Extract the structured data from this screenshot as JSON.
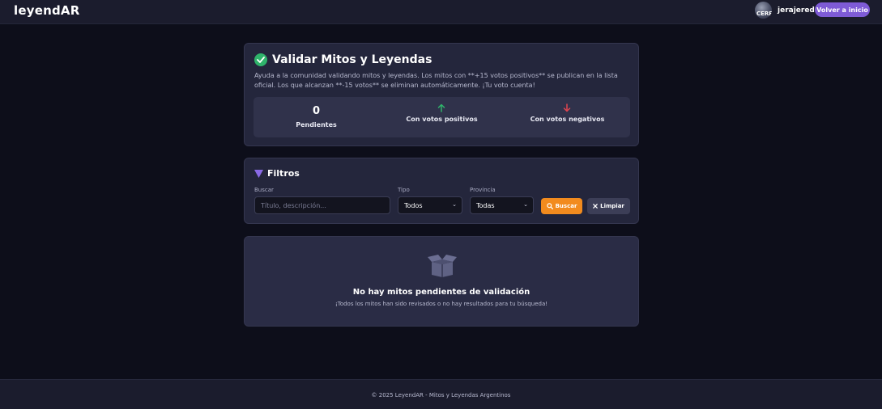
{
  "header": {
    "brand": "leyendAR",
    "avatar_text": "CERF",
    "username": "jerajered",
    "home_button": "Volver a inicio"
  },
  "validate": {
    "title": "Validar Mitos y Leyendas",
    "description": "Ayuda a la comunidad validando mitos y leyendas. Los mitos con **+15 votos positivos** se publican en la lista oficial. Los que alcanzan **-15 votos** se eliminan automáticamente. ¡Tu voto cuenta!",
    "stats": [
      {
        "value": "0",
        "label": "Pendientes"
      },
      {
        "icon": "arrow-up-icon",
        "label": "Con votos positivos",
        "color": "#2fb36b"
      },
      {
        "icon": "arrow-down-icon",
        "label": "Con votos negativos",
        "color": "#e0454f"
      }
    ]
  },
  "filters": {
    "title": "Filtros",
    "search_label": "Buscar",
    "search_placeholder": "Título, descripción...",
    "search_value": "",
    "type_label": "Tipo",
    "type_value": "Todos",
    "province_label": "Provincia",
    "province_value": "Todas",
    "search_button": "Buscar",
    "clear_button": "Limpiar"
  },
  "empty": {
    "title": "No hay mitos pendientes de validación",
    "subtitle": "¡Todos los mitos han sido revisados o no hay resultados para tu búsqueda!"
  },
  "footer": {
    "text": "© 2025 LeyendAR - Mitos y Leyendas Argentinos"
  },
  "colors": {
    "accent": "#7e5bd6",
    "search_button": "#f28b1e",
    "success": "#2fb36b",
    "danger": "#e0454f",
    "background": "#0d0e1a",
    "card": "#24263c"
  }
}
